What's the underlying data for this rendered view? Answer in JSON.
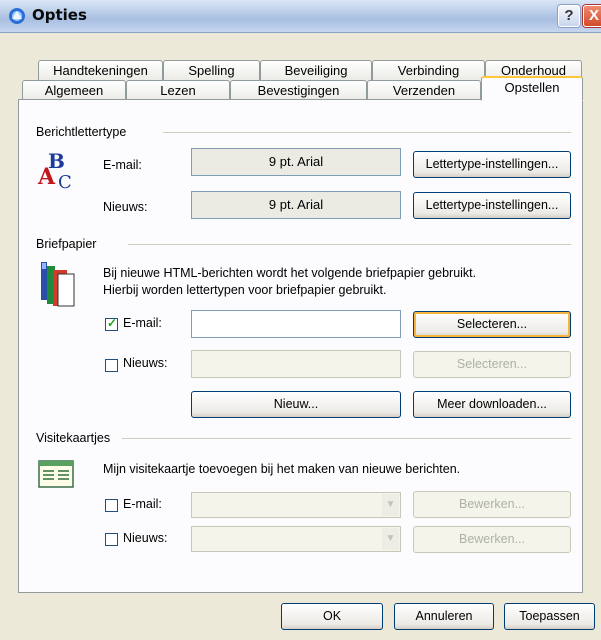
{
  "window": {
    "title": "Opties",
    "help_glyph": "?",
    "close_glyph": "X"
  },
  "tabs_row1": [
    "Handtekeningen",
    "Spelling",
    "Beveiliging",
    "Verbinding",
    "Onderhoud"
  ],
  "tabs_row2": [
    "Algemeen",
    "Lezen",
    "Bevestigingen",
    "Verzenden",
    "Opstellen"
  ],
  "active_tab": "Opstellen",
  "font_section": {
    "title": "Berichtlettertype",
    "email_label": "E-mail:",
    "email_value": "9 pt. Arial",
    "news_label": "Nieuws:",
    "news_value": "9 pt. Arial",
    "font_button": "Lettertype-instellingen..."
  },
  "stationery": {
    "title": "Briefpapier",
    "description_1": "Bij nieuwe HTML-berichten wordt het volgende briefpapier gebruikt.",
    "description_2": "Hierbij worden lettertypen voor briefpapier gebruikt.",
    "email_label": "E-mail:",
    "email_checked": true,
    "news_label": "Nieuws:",
    "news_checked": false,
    "select_button": "Selecteren...",
    "new_button": "Nieuw...",
    "download_button": "Meer downloaden..."
  },
  "business_cards": {
    "title": "Visitekaartjes",
    "description": "Mijn visitekaartje toevoegen bij het maken van nieuwe berichten.",
    "email_label": "E-mail:",
    "news_label": "Nieuws:",
    "edit_button": "Bewerken..."
  },
  "footer": {
    "ok": "OK",
    "cancel": "Annuleren",
    "apply": "Toepassen"
  }
}
